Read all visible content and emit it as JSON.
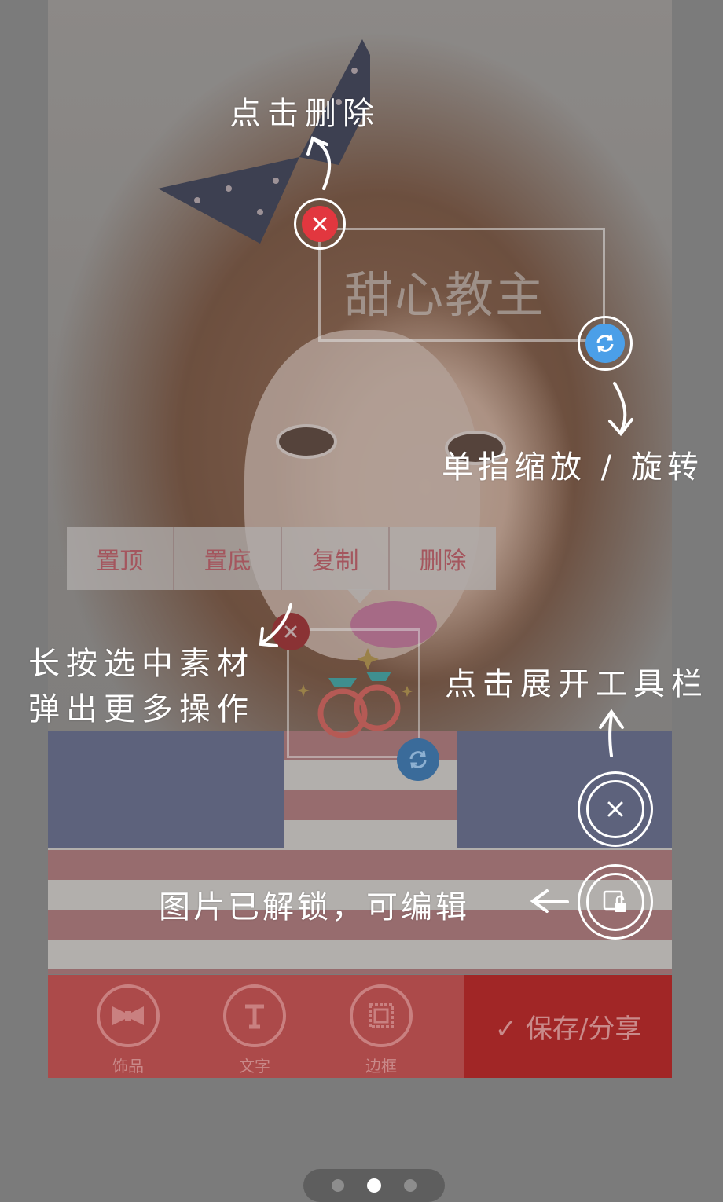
{
  "canvas_text": {
    "text_sticker": "甜心教主"
  },
  "context_menu": {
    "items": [
      "置顶",
      "置底",
      "复制",
      "删除"
    ]
  },
  "annotations": {
    "delete_hint": "点击删除",
    "scale_rotate_hint": "单指缩放 / 旋转",
    "long_press_hint_line1": "长按选中素材",
    "long_press_hint_line2": "弹出更多操作",
    "toolbar_hint": "点击展开工具栏",
    "unlock_hint": "图片已解锁，可编辑"
  },
  "toolbar": {
    "tools": [
      {
        "label": "饰品",
        "icon": "bow-tie-icon"
      },
      {
        "label": "文字",
        "icon": "text-icon"
      },
      {
        "label": "边框",
        "icon": "frame-icon"
      }
    ],
    "save_label": "✓ 保存/分享"
  },
  "pagination": {
    "total": 3,
    "current": 2
  },
  "colors": {
    "delete_red": "#e2373f",
    "rotate_blue": "#4b9fe8",
    "toolbar_red": "#ac4a4a",
    "save_red": "#a12626"
  }
}
